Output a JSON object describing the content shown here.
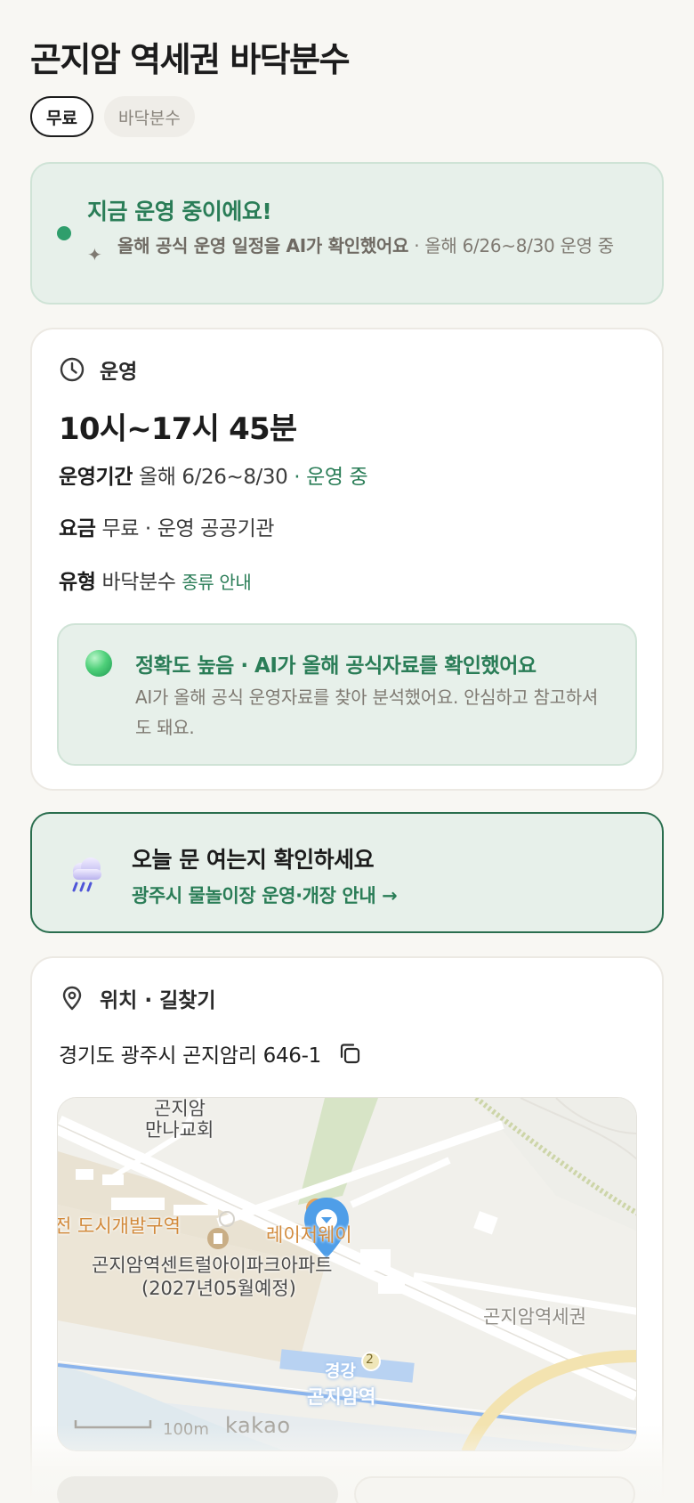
{
  "header": {
    "title": "곤지암 역세권 바닥분수",
    "tags": [
      "무료",
      "바닥분수"
    ]
  },
  "status": {
    "title": "지금 운영 중이에요!",
    "sub_bold": "올해 공식 운영 일정을 AI가 확인했어요",
    "sub_rest": " · 올해 6/26~8/30 운영 중"
  },
  "operation": {
    "section_label": "운영",
    "hours": "10시~17시 45분",
    "period_label": "운영기간",
    "period_value": "올해 6/26~8/30",
    "period_status": " · 운영 중",
    "fee_label": "요금",
    "fee_value": "무료 · 운영 공공기관",
    "type_label": "유형",
    "type_value": "바닥분수",
    "type_link": "종류 안내",
    "accuracy_title": "정확도 높음 · AI가 올해 공식자료를 확인했어요",
    "accuracy_desc": "AI가 올해 공식 운영자료를 찾아 분석했어요. 안심하고 참고하셔도 돼요."
  },
  "today": {
    "title": "오늘 문 여는지 확인하세요",
    "link": "광주시 물놀이장 운영·개장 안내 →"
  },
  "location": {
    "section_label": "위치 · 길찾기",
    "address": "경기도 광주시 곤지암리 646-1",
    "map": {
      "labels": {
        "church_1": "곤지암",
        "church_2": "만나교회",
        "district": "전 도시개발구역",
        "leisure": "레이저웨이",
        "apartment_1": "곤지암역센트럴아이파크아파트",
        "apartment_2": "(2027년05월예정)",
        "area": "곤지암역세권",
        "line": "경강",
        "line_no": "2",
        "station": "곤지암역",
        "scale": "100m",
        "brand": "kakao"
      }
    }
  },
  "colors": {
    "accent_green": "#2a7d57",
    "card_green": "#e7f0ea",
    "pin_blue": "#4f9ee8"
  }
}
